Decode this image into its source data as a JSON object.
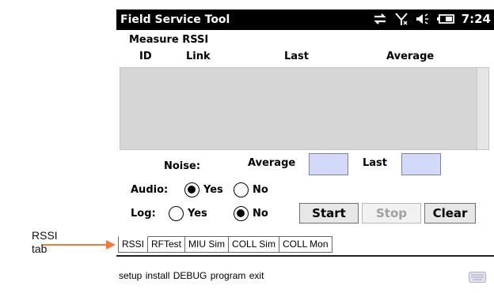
{
  "window": {
    "title": "Field Service Tool",
    "time": "7:24"
  },
  "status_icons": [
    "connectivity-icon",
    "signal-off-icon",
    "speaker-icon",
    "battery-icon"
  ],
  "screen": {
    "heading": "Measure RSSI",
    "columns": [
      "ID",
      "Link",
      "Last",
      "Average"
    ],
    "noise": {
      "label": "Noise:",
      "average_label": "Average",
      "average_value": "",
      "last_label": "Last",
      "last_value": ""
    },
    "audio": {
      "label": "Audio:",
      "options": [
        "Yes",
        "No"
      ],
      "selected": "Yes"
    },
    "log": {
      "label": "Log:",
      "options": [
        "Yes",
        "No"
      ],
      "selected": "No"
    },
    "buttons": {
      "start": "Start",
      "stop": "Stop",
      "clear": "Clear"
    }
  },
  "tabs": [
    {
      "label": "RSSI",
      "active": true
    },
    {
      "label": "RFTest",
      "active": false
    },
    {
      "label": "MIU Sim",
      "active": false
    },
    {
      "label": "COLL Sim",
      "active": false
    },
    {
      "label": "COLL Mon",
      "active": false
    }
  ],
  "menu": {
    "items": "setup install DEBUG program exit"
  },
  "callout": {
    "line1": "RSSI",
    "line2": "tab"
  },
  "colors": {
    "field_bg": "#d5d9f8",
    "arrow": "#f07a3a",
    "list_bg": "#d6d6d6"
  }
}
